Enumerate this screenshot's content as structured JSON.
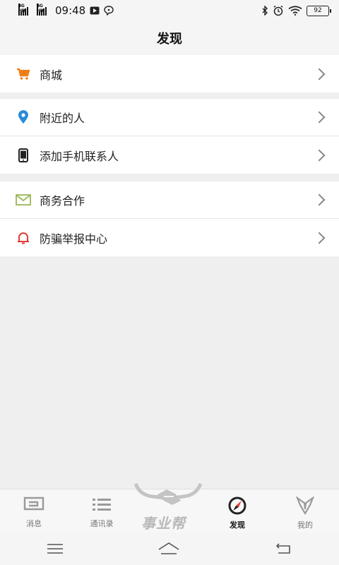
{
  "status": {
    "signal1": "4G HD",
    "signal2": "4G HD",
    "time": "09:48",
    "battery": "92"
  },
  "header": {
    "title": "发现"
  },
  "groups": [
    {
      "items": [
        {
          "label": "商城",
          "icon": "cart-icon"
        }
      ]
    },
    {
      "items": [
        {
          "label": "附近的人",
          "icon": "location-pin-icon"
        },
        {
          "label": "添加手机联系人",
          "icon": "phone-icon"
        }
      ]
    },
    {
      "items": [
        {
          "label": "商务合作",
          "icon": "envelope-icon"
        },
        {
          "label": "防骗举报中心",
          "icon": "bell-icon"
        }
      ]
    }
  ],
  "tabbar": {
    "tabs": [
      {
        "label": "消息",
        "icon": "message-icon"
      },
      {
        "label": "通讯录",
        "icon": "contacts-list-icon"
      },
      {
        "label": "事业帮",
        "icon": "logo-icon"
      },
      {
        "label": "发现",
        "icon": "compass-icon",
        "active": true
      },
      {
        "label": "我的",
        "icon": "profile-icon"
      }
    ]
  },
  "colors": {
    "accent_orange": "#f07f1a",
    "pin_blue": "#2a8bd8",
    "envelope_green": "#9ab654",
    "bell_red": "#e23b3b"
  }
}
